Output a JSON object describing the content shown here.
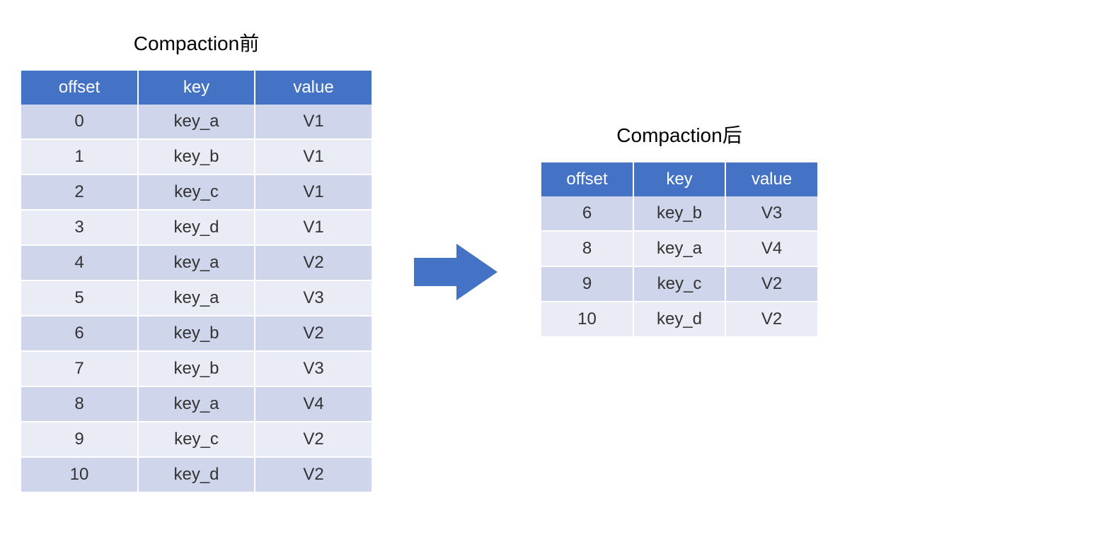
{
  "left": {
    "title": "Compaction前",
    "headers": {
      "offset": "offset",
      "key": "key",
      "value": "value"
    },
    "rows": [
      {
        "offset": "0",
        "key": "key_a",
        "value": "V1"
      },
      {
        "offset": "1",
        "key": "key_b",
        "value": "V1"
      },
      {
        "offset": "2",
        "key": "key_c",
        "value": "V1"
      },
      {
        "offset": "3",
        "key": "key_d",
        "value": "V1"
      },
      {
        "offset": "4",
        "key": "key_a",
        "value": "V2"
      },
      {
        "offset": "5",
        "key": "key_a",
        "value": "V3"
      },
      {
        "offset": "6",
        "key": "key_b",
        "value": "V2"
      },
      {
        "offset": "7",
        "key": "key_b",
        "value": "V3"
      },
      {
        "offset": "8",
        "key": "key_a",
        "value": "V4"
      },
      {
        "offset": "9",
        "key": "key_c",
        "value": "V2"
      },
      {
        "offset": "10",
        "key": "key_d",
        "value": "V2"
      }
    ]
  },
  "right": {
    "title": "Compaction后",
    "headers": {
      "offset": "offset",
      "key": "key",
      "value": "value"
    },
    "rows": [
      {
        "offset": "6",
        "key": "key_b",
        "value": "V3"
      },
      {
        "offset": "8",
        "key": "key_a",
        "value": "V4"
      },
      {
        "offset": "9",
        "key": "key_c",
        "value": "V2"
      },
      {
        "offset": "10",
        "key": "key_d",
        "value": "V2"
      }
    ]
  },
  "colors": {
    "header": "#4472c4",
    "row_odd": "#cfd5ea",
    "row_even": "#e9ebf5"
  }
}
